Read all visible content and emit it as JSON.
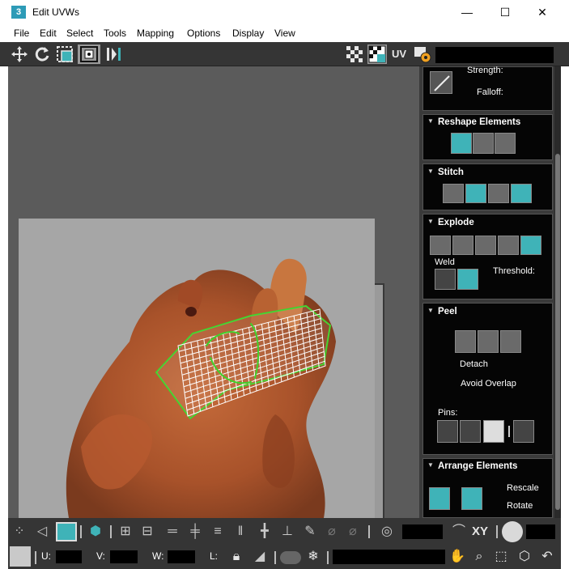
{
  "window": {
    "app_icon": "3",
    "title": "Edit UVWs",
    "minimize": "—",
    "maximize": "☐",
    "close": "✕"
  },
  "menu": [
    "File",
    "Edit",
    "Select",
    "Tools",
    "Mapping",
    "Options",
    "Display",
    "View"
  ],
  "toolbar_top": {
    "uv_label": "UV",
    "icons": [
      "move-icon",
      "rotate-icon",
      "scale-icon",
      "freeform-icon",
      "mirror-icon",
      "checker-icon",
      "checker-pattern-icon",
      "uv-settings-icon"
    ]
  },
  "panel": {
    "soft_select": {
      "strength_label": "Strength:",
      "falloff_label": "Falloff:"
    },
    "reshape": {
      "title": "Reshape Elements"
    },
    "stitch": {
      "title": "Stitch"
    },
    "explode": {
      "title": "Explode",
      "weld_label": "Weld",
      "threshold_label": "Threshold:"
    },
    "peel": {
      "title": "Peel",
      "detach_label": "Detach",
      "avoid_overlap_label": "Avoid Overlap",
      "pins_label": "Pins:"
    },
    "arrange": {
      "title": "Arrange Elements",
      "rescale_label": "Rescale",
      "rotate_label": "Rotate"
    },
    "collapse_glyph": "▼"
  },
  "bottom_toolbar": {
    "xy_label": "XY",
    "u_label": "U:",
    "v_label": "V:",
    "w_label": "W:",
    "l_label": "L:"
  },
  "colors": {
    "accent_teal": "#3fb3b8",
    "uv_mesh_green": "#3fd22b",
    "toolbar_bg": "#353535"
  }
}
